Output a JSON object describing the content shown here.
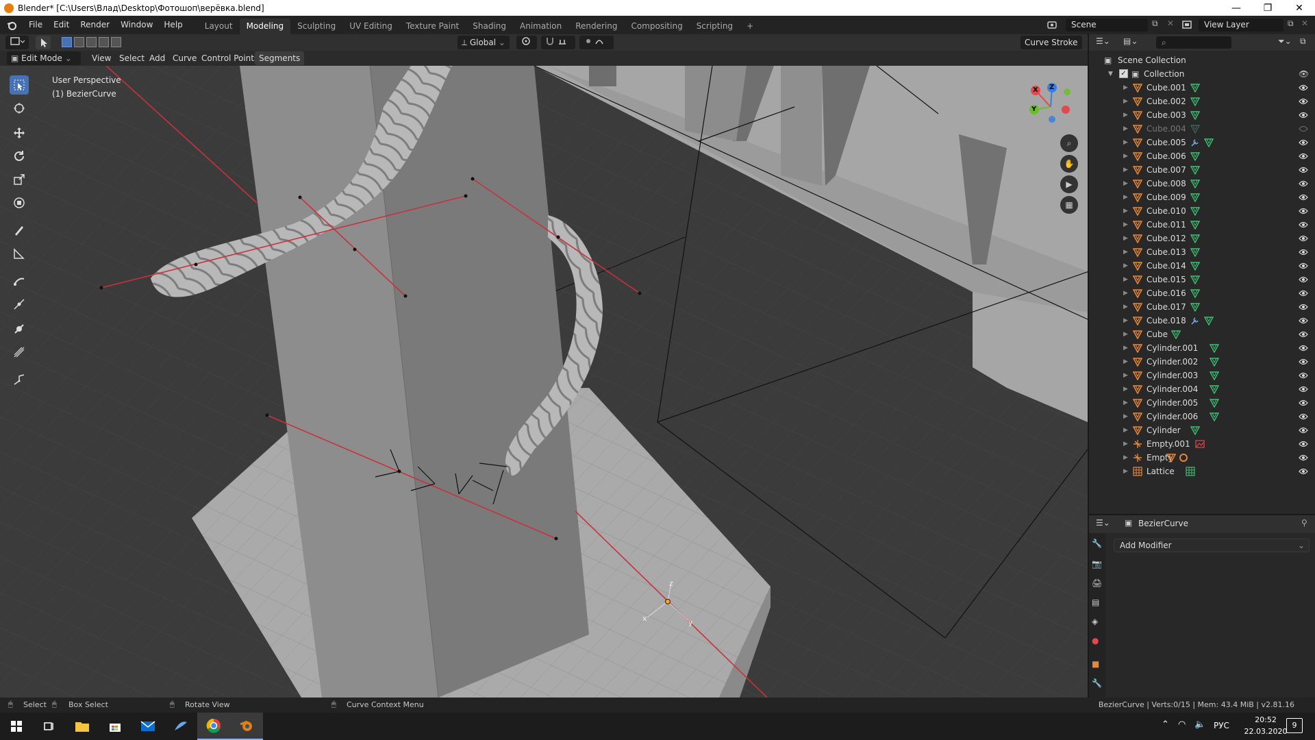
{
  "window": {
    "title": "Blender* [C:\\Users\\Влад\\Desktop\\Фотошоп\\верёвка.blend]",
    "minimize": "—",
    "restore": "❐",
    "close": "✕"
  },
  "menu": [
    "File",
    "Edit",
    "Render",
    "Window",
    "Help"
  ],
  "workspaces": [
    "Layout",
    "Modeling",
    "Sculpting",
    "UV Editing",
    "Texture Paint",
    "Shading",
    "Animation",
    "Rendering",
    "Compositing",
    "Scripting"
  ],
  "active_workspace": "Modeling",
  "add_workspace": "+",
  "scene_name": "Scene",
  "view_layer": "View Layer",
  "viewport_header": {
    "mode": "Edit Mode",
    "menus": [
      "View",
      "Select",
      "Add",
      "Curve",
      "Control Points",
      "Segments"
    ],
    "transform_orientation": "Global",
    "curve_stroke": "Curve Stroke"
  },
  "overlay_text": {
    "perspective": "User Perspective",
    "object": "(1) BezierCurve"
  },
  "gizmo": {
    "x": "X",
    "y": "Y",
    "z": "Z"
  },
  "origin_axes": {
    "x": "x",
    "y": "y",
    "z": "z"
  },
  "outliner": {
    "root": "Scene Collection",
    "collection": "Collection",
    "items": [
      {
        "name": "Cube.001",
        "type": "mesh",
        "visible": true
      },
      {
        "name": "Cube.002",
        "type": "mesh",
        "visible": true
      },
      {
        "name": "Cube.003",
        "type": "mesh",
        "visible": true
      },
      {
        "name": "Cube.004",
        "type": "mesh",
        "visible": false
      },
      {
        "name": "Cube.005",
        "type": "mesh-modifier",
        "visible": true
      },
      {
        "name": "Cube.006",
        "type": "mesh",
        "visible": true
      },
      {
        "name": "Cube.007",
        "type": "mesh",
        "visible": true
      },
      {
        "name": "Cube.008",
        "type": "mesh",
        "visible": true
      },
      {
        "name": "Cube.009",
        "type": "mesh",
        "visible": true
      },
      {
        "name": "Cube.010",
        "type": "mesh",
        "visible": true
      },
      {
        "name": "Cube.011",
        "type": "mesh",
        "visible": true
      },
      {
        "name": "Cube.012",
        "type": "mesh",
        "visible": true
      },
      {
        "name": "Cube.013",
        "type": "mesh",
        "visible": true
      },
      {
        "name": "Cube.014",
        "type": "mesh",
        "visible": true
      },
      {
        "name": "Cube.015",
        "type": "mesh",
        "visible": true
      },
      {
        "name": "Cube.016",
        "type": "mesh",
        "visible": true
      },
      {
        "name": "Cube.017",
        "type": "mesh",
        "visible": true
      },
      {
        "name": "Cube.018",
        "type": "mesh-modifier",
        "visible": true
      },
      {
        "name": "Cube",
        "type": "mesh",
        "visible": true
      },
      {
        "name": "Cylinder.001",
        "type": "mesh",
        "visible": true
      },
      {
        "name": "Cylinder.002",
        "type": "mesh",
        "visible": true
      },
      {
        "name": "Cylinder.003",
        "type": "mesh",
        "visible": true
      },
      {
        "name": "Cylinder.004",
        "type": "mesh",
        "visible": true
      },
      {
        "name": "Cylinder.005",
        "type": "mesh",
        "visible": true
      },
      {
        "name": "Cylinder.006",
        "type": "mesh",
        "visible": true
      },
      {
        "name": "Cylinder",
        "type": "mesh",
        "visible": true
      },
      {
        "name": "Empty.001",
        "type": "empty-image",
        "visible": true
      },
      {
        "name": "Empty",
        "type": "empty",
        "visible": true
      },
      {
        "name": "Lattice",
        "type": "lattice",
        "visible": true
      }
    ]
  },
  "properties": {
    "object_name": "BezierCurve",
    "add_modifier": "Add Modifier"
  },
  "statusbar": {
    "select": "Select",
    "box_select": "Box Select",
    "rotate_view": "Rotate View",
    "context_menu": "Curve Context Menu",
    "info": "BezierCurve | Verts:0/15 | Mem: 43.4 MiB | v2.81.16"
  },
  "taskbar": {
    "language": "РУС",
    "time": "20:52",
    "date": "22.03.2020",
    "notifications": "9"
  },
  "colors": {
    "accent": "#4772b3",
    "blender_orange": "#e87d0d",
    "mesh_icon": "#e5883b",
    "data_icon": "#3cc070",
    "curve_red": "#c8323c"
  }
}
